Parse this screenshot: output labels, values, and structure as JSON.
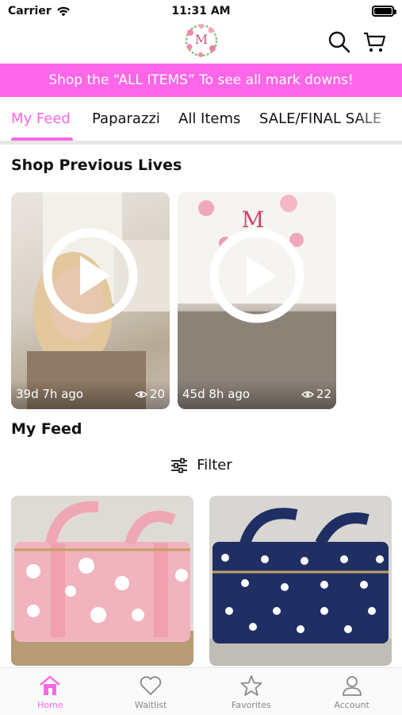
{
  "status_bar": {
    "carrier": "Carrier",
    "time": "11:31 AM"
  },
  "header": {
    "logo_letter": "M"
  },
  "promo": {
    "text": "Shop the “ALL ITEMS” To see all mark downs!",
    "color": "#ff66e8"
  },
  "tabs": [
    {
      "label": "My Feed",
      "active": true
    },
    {
      "label": "Paparazzi",
      "active": false
    },
    {
      "label": "All Items",
      "active": false
    },
    {
      "label": "SALE/FINAL SALE",
      "active": false
    }
  ],
  "sections": {
    "previous_lives": "Shop Previous Lives",
    "my_feed": "My Feed"
  },
  "lives": [
    {
      "age": "39d 7h ago",
      "views": "20"
    },
    {
      "age": "45d 8h ago",
      "views": "22"
    }
  ],
  "filter": {
    "label": "Filter"
  },
  "products": [
    {
      "pattern": "pink-daisy-cooler-bag",
      "main_color": "#f1b3bd"
    },
    {
      "pattern": "navy-polka-dot-cooler-bag",
      "main_color": "#1f2f63"
    }
  ],
  "bottom_nav": [
    {
      "label": "Home",
      "icon": "home-icon",
      "active": true
    },
    {
      "label": "Waitlist",
      "icon": "heart-icon",
      "active": false
    },
    {
      "label": "Favorites",
      "icon": "star-icon",
      "active": false
    },
    {
      "label": "Account",
      "icon": "person-icon",
      "active": false
    }
  ],
  "accent_color": "#ff66e8"
}
